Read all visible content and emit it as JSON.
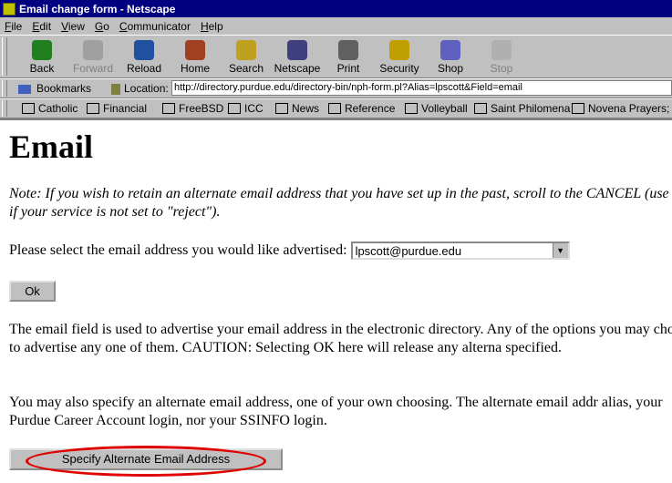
{
  "window": {
    "title": "Email change form - Netscape"
  },
  "menu": [
    "File",
    "Edit",
    "View",
    "Go",
    "Communicator",
    "Help"
  ],
  "menu_underlines": [
    "F",
    "E",
    "V",
    "G",
    "C",
    "H"
  ],
  "toolbar": [
    {
      "label": "Back",
      "icon": "back-arrow-icon"
    },
    {
      "label": "Forward",
      "icon": "forward-arrow-icon",
      "disabled": true
    },
    {
      "label": "Reload",
      "icon": "reload-icon"
    },
    {
      "label": "Home",
      "icon": "home-icon"
    },
    {
      "label": "Search",
      "icon": "search-icon"
    },
    {
      "label": "Netscape",
      "icon": "netscape-icon"
    },
    {
      "label": "Print",
      "icon": "printer-icon"
    },
    {
      "label": "Security",
      "icon": "lock-icon"
    },
    {
      "label": "Shop",
      "icon": "shop-icon"
    },
    {
      "label": "Stop",
      "icon": "stop-icon",
      "disabled": true
    }
  ],
  "location": {
    "bookmarks_label": "Bookmarks",
    "location_label": "Location:",
    "url": "http://directory.purdue.edu/directory-bin/nph-form.pl?Alias=lpscott&Field=email"
  },
  "personal_toolbar": [
    "Catholic",
    "Financial",
    "FreeBSD",
    "ICC",
    "News",
    "Reference",
    "Volleyball",
    "Saint Philomena",
    "Novena Prayers;"
  ],
  "page": {
    "heading": "Email",
    "note": "Note: If you wish to retain an alternate email address that you have set up in the past, scroll to the CANCEL (use only if your service is not set to \"reject\").",
    "select_label": "Please select the email address you would like advertised:",
    "select_value": "lpscott@purdue.edu",
    "ok_button": "Ok",
    "para1": "The email field is used to advertise your email address in the electronic directory. Any of the options you may choose to advertise any one of them. CAUTION: Selecting OK here will release any alterna specified.",
    "para2": "You may also specify an alternate email address, one of your own choosing. The alternate email addr alias, your Purdue Career Account login, nor your SSINFO login.",
    "alt_button": "Specify Alternate Email Address"
  },
  "colors": {
    "titlebar": "#000080",
    "highlight_circle": "#e00000",
    "chrome": "#c0c0c0"
  }
}
